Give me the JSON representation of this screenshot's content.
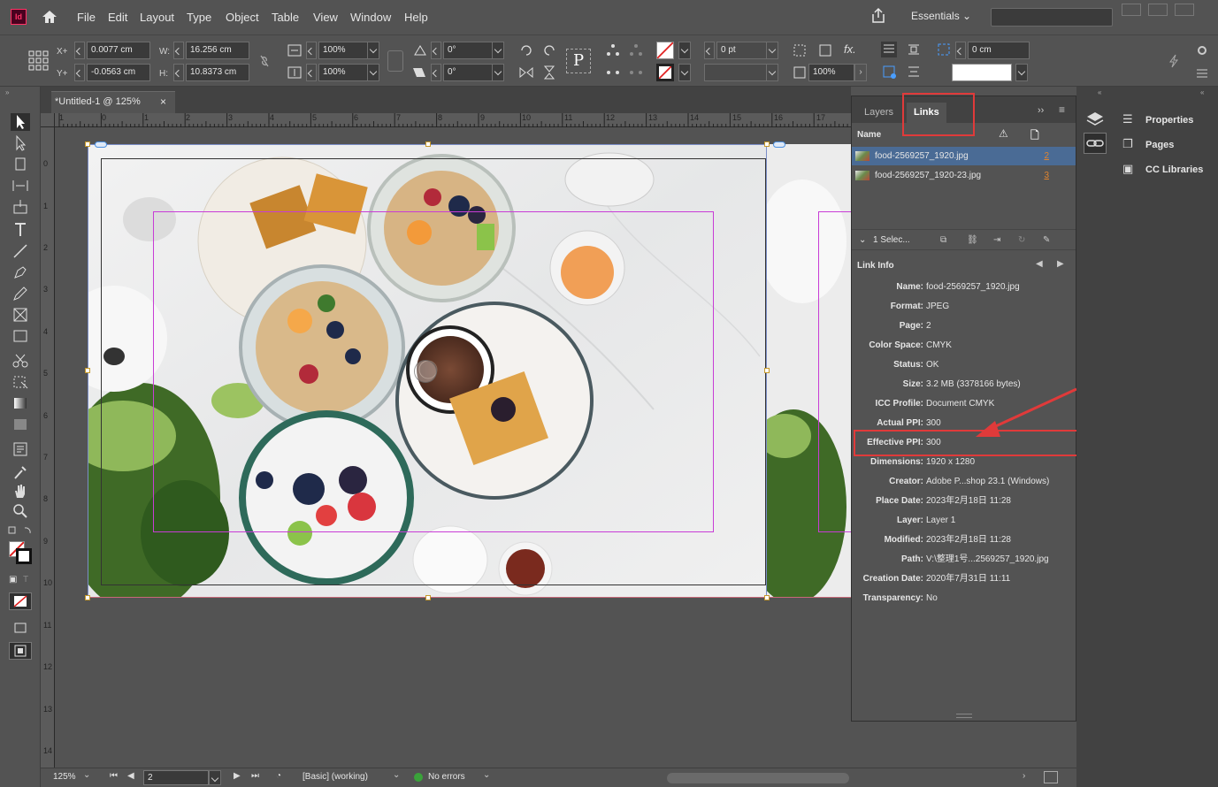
{
  "app": {
    "logo": "Id",
    "workspace": "Essentials"
  },
  "menu": [
    "File",
    "Edit",
    "Layout",
    "Type",
    "Object",
    "Table",
    "View",
    "Window",
    "Help"
  ],
  "control": {
    "x_label": "X+",
    "x_value": "0.0077 cm",
    "y_label": "Y+",
    "y_value": "-0.0563 cm",
    "w_label": "W:",
    "w_value": "16.256 cm",
    "h_label": "H:",
    "h_value": "10.8373 cm",
    "scale_x": "100%",
    "scale_y": "100%",
    "rotate": "0°",
    "shear": "0°",
    "stroke_weight": "0 pt",
    "offset": "0 cm",
    "opacity": "100%"
  },
  "document": {
    "tab_title": "*Untitled-1 @ 125%",
    "close_symbol": "×"
  },
  "ruler": {
    "h_ticks": [
      "1",
      "0",
      "1",
      "2",
      "3",
      "4",
      "5",
      "6",
      "7",
      "8",
      "9",
      "10",
      "11",
      "12",
      "13",
      "14",
      "15",
      "16",
      "17"
    ],
    "v_ticks": [
      "0",
      "1",
      "2",
      "3",
      "4",
      "5",
      "6",
      "7",
      "8",
      "9",
      "10",
      "11",
      "12",
      "13",
      "14"
    ]
  },
  "status": {
    "zoom": "125%",
    "page": "2",
    "style": "[Basic] (working)",
    "preflight": "No errors"
  },
  "right_panel": {
    "items": [
      "Properties",
      "Pages",
      "CC Libraries"
    ]
  },
  "links_panel": {
    "tabs": [
      "Layers",
      "Links"
    ],
    "col_name": "Name",
    "rows": [
      {
        "name": "food-2569257_1920.jpg",
        "page": "2"
      },
      {
        "name": "food-2569257_1920-23.jpg",
        "page": "3"
      }
    ],
    "selection": "1 Selec...",
    "info_title": "Link Info",
    "info": [
      {
        "label": "Name:",
        "value": "food-2569257_1920.jpg"
      },
      {
        "label": "Format:",
        "value": "JPEG"
      },
      {
        "label": "Page:",
        "value": "2"
      },
      {
        "label": "Color Space:",
        "value": "CMYK"
      },
      {
        "label": "Status:",
        "value": "OK"
      },
      {
        "label": "Size:",
        "value": "3.2 MB (3378166 bytes)"
      },
      {
        "label": "ICC Profile:",
        "value": "Document CMYK"
      },
      {
        "label": "Actual PPI:",
        "value": "300"
      },
      {
        "label": "Effective PPI:",
        "value": "300"
      },
      {
        "label": "Dimensions:",
        "value": "1920 x 1280"
      },
      {
        "label": "Creator:",
        "value": "Adobe P...shop 23.1 (Windows)"
      },
      {
        "label": "Place Date:",
        "value": "2023年2月18日 11:28"
      },
      {
        "label": "Layer:",
        "value": "Layer 1"
      },
      {
        "label": "Modified:",
        "value": "2023年2月18日 11:28"
      },
      {
        "label": "Path:",
        "value": "V:\\整理1号...2569257_1920.jpg"
      },
      {
        "label": "Creation Date:",
        "value": "2020年7月31日 11:11"
      },
      {
        "label": "Transparency:",
        "value": "No"
      }
    ]
  },
  "colors": {
    "accent_orange": "#e0842f",
    "highlight_red": "#e03a3a",
    "selection_blue": "#4a6b95"
  }
}
